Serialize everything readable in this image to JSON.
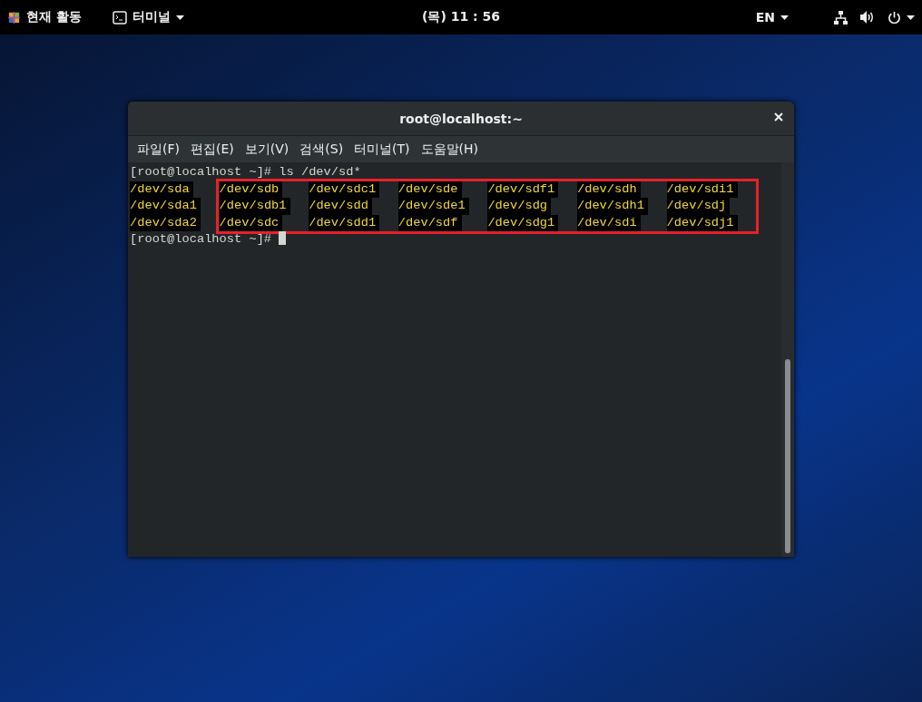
{
  "top_bar": {
    "activities": "현재 활동",
    "app_menu": "터미널",
    "clock": "(목) 11 : 56",
    "language": "EN"
  },
  "window": {
    "title": "root@localhost:~"
  },
  "menu": [
    "파일(F)",
    "편집(E)",
    "보기(V)",
    "검색(S)",
    "터미널(T)",
    "도움말(H)"
  ],
  "terminal": {
    "command_line": "[root@localhost ~]# ls /dev/sd*",
    "prompt": "[root@localhost ~]#",
    "output_columns": [
      {
        "entries": [
          "/dev/sda",
          "/dev/sda1",
          "/dev/sda2"
        ]
      }
    ],
    "highlight_box": {
      "output_columns": [
        {
          "entries": [
            "/dev/sdb",
            "/dev/sdb1",
            "/dev/sdc"
          ]
        },
        {
          "entries": [
            "/dev/sdc1",
            "/dev/sdd",
            "/dev/sdd1"
          ]
        },
        {
          "entries": [
            "/dev/sde",
            "/dev/sde1",
            "/dev/sdf"
          ]
        },
        {
          "entries": [
            "/dev/sdf1",
            "/dev/sdg",
            "/dev/sdg1"
          ]
        },
        {
          "entries": [
            "/dev/sdh",
            "/dev/sdh1",
            "/dev/sdi"
          ]
        },
        {
          "entries": [
            "/dev/sdi1",
            "/dev/sdj",
            "/dev/sdj1"
          ]
        }
      ]
    }
  }
}
